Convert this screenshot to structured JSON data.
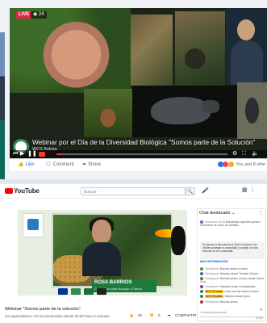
{
  "facebook": {
    "live_label": "LIVE",
    "viewers": "24",
    "caption_title": "Webinar por el Día de la Diversidad Biológica \"Somos parte de la Solución\"",
    "caption_sub": "WCS Bolivia",
    "progress_fraction": 0.03,
    "actions": {
      "like": "Like",
      "comment": "Comment",
      "share": "Share"
    },
    "reactions_text": "You and 8 othe"
  },
  "youtube": {
    "logo": "YouTube",
    "search_placeholder": "Buscar",
    "search_icon": "search-icon",
    "player": {
      "name": "ROSA BARRIOS",
      "role": "Consultora para Bosque y Fauna"
    },
    "video_title": "Webinar \"Somos parte de la solución\"",
    "meta": "24 espectadores • En la transmisión desde 00:00 hace 9 minutos",
    "actions": {
      "likes": "19",
      "dislikes": "0",
      "share": "COMPARTIR",
      "save": "GUARDAR"
    },
    "chat": {
      "header": "Chat destacado",
      "line1_name": "Requisitos 50",
      "line1_text": "SI Bolivianitas vigentes pueden informarse de todos los detalles...",
      "pinned": "Te damos la bienvenida al Chat en directo. No olvides proteger tu privacidad y cumplir con las Normas de la Comunidad.",
      "more_info": "MÁS INFORMACIÓN",
      "messages": [
        {
          "name": "Participante",
          "text": "Buenas tardes a todos"
        },
        {
          "name": "Participante",
          "text": "Saludos desde Trinidad, Bolivia"
        },
        {
          "name": "Participante",
          "text": "Buenas tardes a todos desde Santa Cruz"
        },
        {
          "name": "Participante",
          "text": "Saludos desde Cochabamba"
        },
        {
          "name": "WCS Ecuador",
          "text": "Hola, buenas tardes a todos",
          "highlight": true
        },
        {
          "name": "WCS Ecuador",
          "text": "Saludos desde Quito",
          "highlight": true
        },
        {
          "name": "Participante",
          "text": "Buenas tardes"
        }
      ],
      "input_placeholder": "Chatea públicamente",
      "counter": "0/200"
    }
  },
  "colors": {
    "live_red": "#e42645",
    "fb_blue": "#1877f2",
    "yt_red": "#ff0000",
    "plate_green": "#1e7a3c"
  }
}
